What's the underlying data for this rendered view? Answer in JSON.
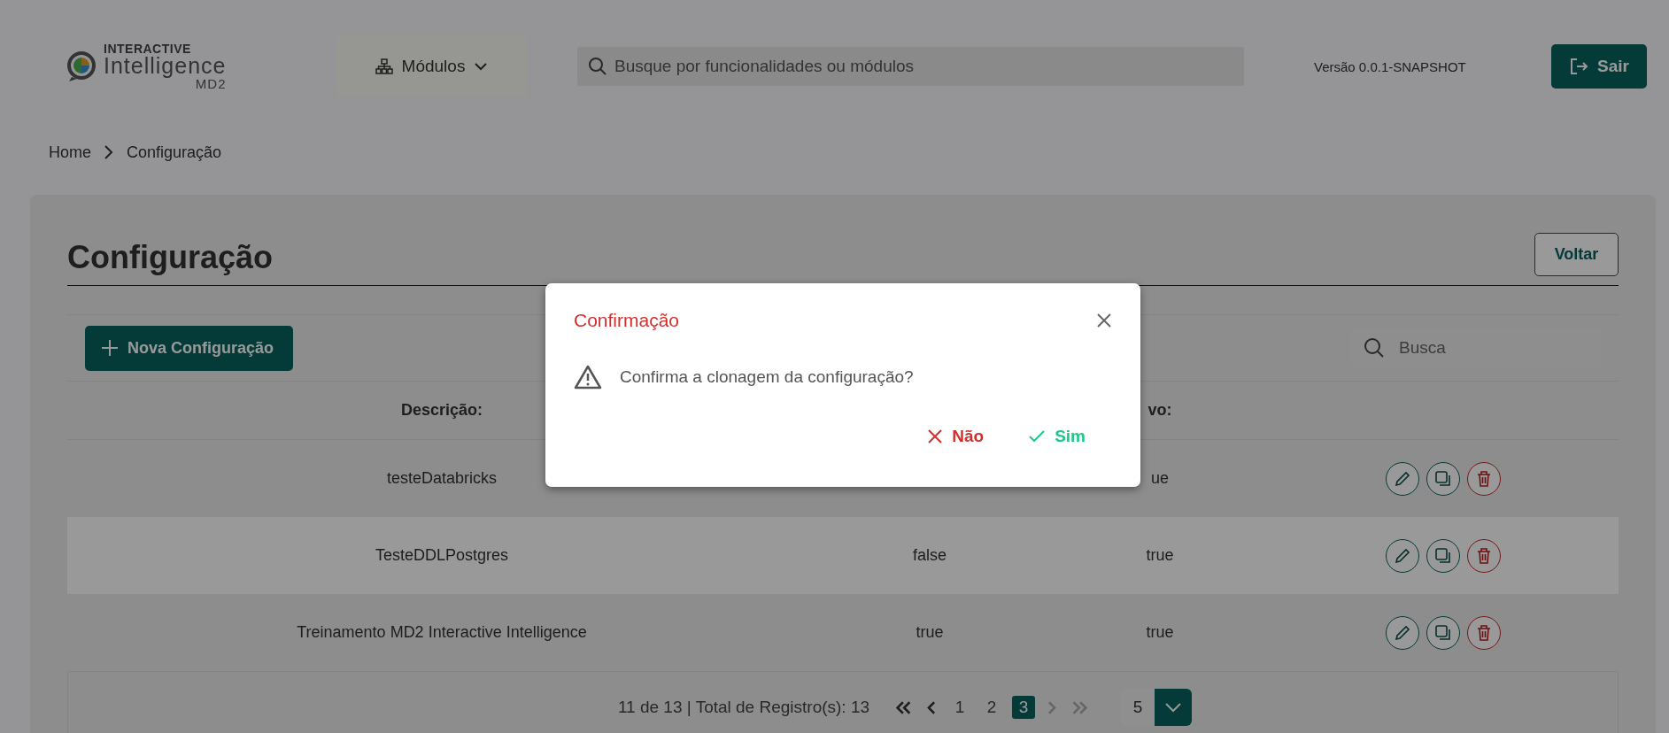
{
  "header": {
    "logo": {
      "line1": "INTERACTIVE",
      "line2": "Intelligence",
      "line3": "MD2"
    },
    "modules_button": "Módulos",
    "search": {
      "placeholder": "Busque por funcionalidades ou módulos"
    },
    "version": "Versão 0.0.1-SNAPSHOT",
    "logout_button": "Sair"
  },
  "breadcrumb": [
    {
      "label": "Home"
    },
    {
      "label": "Configuração"
    }
  ],
  "page": {
    "title": "Configuração",
    "back_button": "Voltar",
    "new_button": "Nova Configuração",
    "search": {
      "placeholder": "Busca"
    }
  },
  "table": {
    "columns": {
      "column_1": "Descrição:",
      "column_3": "vo:"
    },
    "rows": [
      {
        "description": "testeDatabricks",
        "column_3": "ue",
        "highlighted": false
      },
      {
        "description": "TesteDDLPostgres",
        "column_2": "false",
        "column_3": "true",
        "highlighted": true
      },
      {
        "description": "Treinamento MD2 Interactive Intelligence",
        "column_2": "true",
        "column_3": "true",
        "highlighted": false
      }
    ]
  },
  "pagination": {
    "summary": "11 de 13 | Total de Registro(s): 13",
    "nav": [
      {
        "kind": "first",
        "disabled": false
      },
      {
        "kind": "prev",
        "disabled": false
      },
      {
        "kind": "next",
        "disabled": true
      },
      {
        "kind": "last",
        "disabled": true
      }
    ],
    "pages": [
      {
        "label": "1",
        "selected": false
      },
      {
        "label": "2",
        "selected": false
      },
      {
        "label": "3",
        "selected": true
      }
    ],
    "page_size": "5"
  },
  "dialog": {
    "title": "Confirmação",
    "message": "Confirma a clonagem da configuração?",
    "buttons": [
      {
        "kind": "cancel",
        "label": "Não"
      },
      {
        "kind": "confirm",
        "label": "Sim"
      }
    ]
  }
}
